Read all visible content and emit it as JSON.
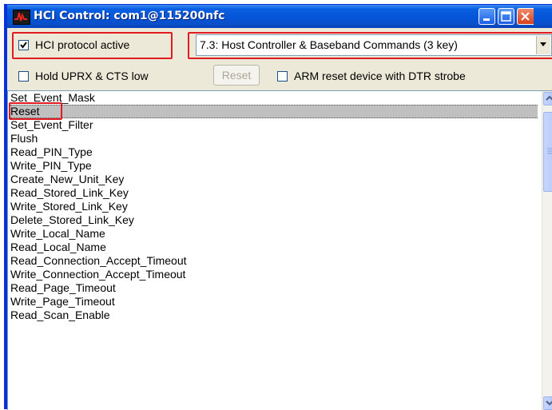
{
  "window": {
    "title": "HCI Control: com1@115200nfc",
    "icon": "app-logo-icon",
    "controls": [
      "minimize-icon",
      "maximize-icon",
      "close-icon"
    ]
  },
  "controls": {
    "protocol_active": {
      "label": "HCI protocol active",
      "checked": true
    },
    "command_group": {
      "value": "7.3: Host Controller & Baseband Commands (3 key)"
    },
    "hold_uprx": {
      "label": "Hold UPRX & CTS low",
      "checked": false
    },
    "reset_button": {
      "label": "Reset",
      "enabled": false
    },
    "arm_reset": {
      "label": "ARM reset device with DTR strobe",
      "checked": false
    }
  },
  "commands": [
    "Set_Event_Mask",
    "Reset",
    "Set_Event_Filter",
    "Flush",
    "Read_PIN_Type",
    "Write_PIN_Type",
    "Create_New_Unit_Key",
    "Read_Stored_Link_Key",
    "Write_Stored_Link_Key",
    "Delete_Stored_Link_Key",
    "Write_Local_Name",
    "Read_Local_Name",
    "Read_Connection_Accept_Timeout",
    "Write_Connection_Accept_Timeout",
    "Read_Page_Timeout",
    "Write_Page_Timeout",
    "Read_Scan_Enable"
  ],
  "selected_index": 1,
  "colors": {
    "highlight": "#e11b22",
    "titlebar": "#0455d8",
    "selection": "#c0c0c0"
  }
}
